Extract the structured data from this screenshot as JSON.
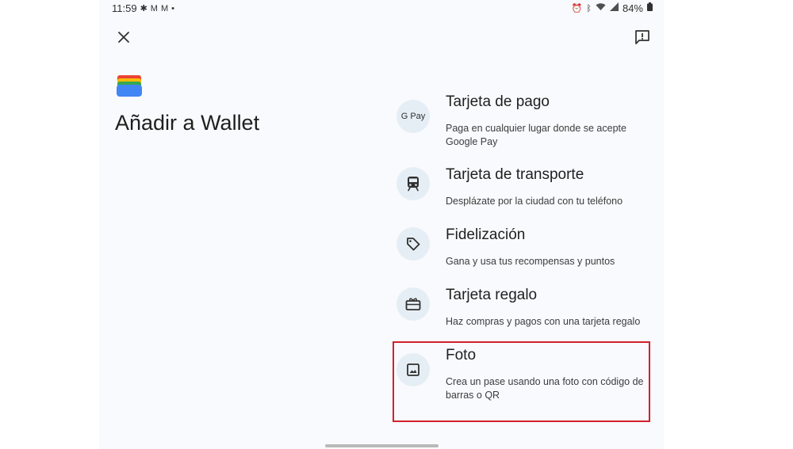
{
  "status_bar": {
    "time": "11:59",
    "notification_icons": [
      "fan-icon",
      "gmail-icon",
      "gmail-icon",
      "dot-icon"
    ],
    "system_icons": [
      "alarm-icon",
      "bluetooth-icon",
      "wifi-icon",
      "signal-icon"
    ],
    "battery": "84%"
  },
  "header": {
    "close_icon": "close-icon",
    "feedback_icon": "feedback-icon"
  },
  "page": {
    "title": "Añadir a Wallet"
  },
  "options": [
    {
      "title": "Tarjeta de pago",
      "subtitle": "Paga en cualquier lugar donde se acepte Google Pay",
      "icon": "gpay-icon",
      "icon_text": "G Pay"
    },
    {
      "title": "Tarjeta de transporte",
      "subtitle": "Desplázate por la ciudad con tu teléfono",
      "icon": "train-icon"
    },
    {
      "title": "Fidelización",
      "subtitle": "Gana y usa tus recompensas y puntos",
      "icon": "tag-icon"
    },
    {
      "title": "Tarjeta regalo",
      "subtitle": "Haz compras y pagos con una tarjeta regalo",
      "icon": "gift-card-icon"
    },
    {
      "title": "Foto",
      "subtitle": "Crea un pase usando una foto con código de barras o QR",
      "icon": "photo-icon"
    }
  ],
  "colors": {
    "background": "#f8fafd",
    "icon_circle": "#e6eef5",
    "highlight_border": "#d3202a"
  }
}
